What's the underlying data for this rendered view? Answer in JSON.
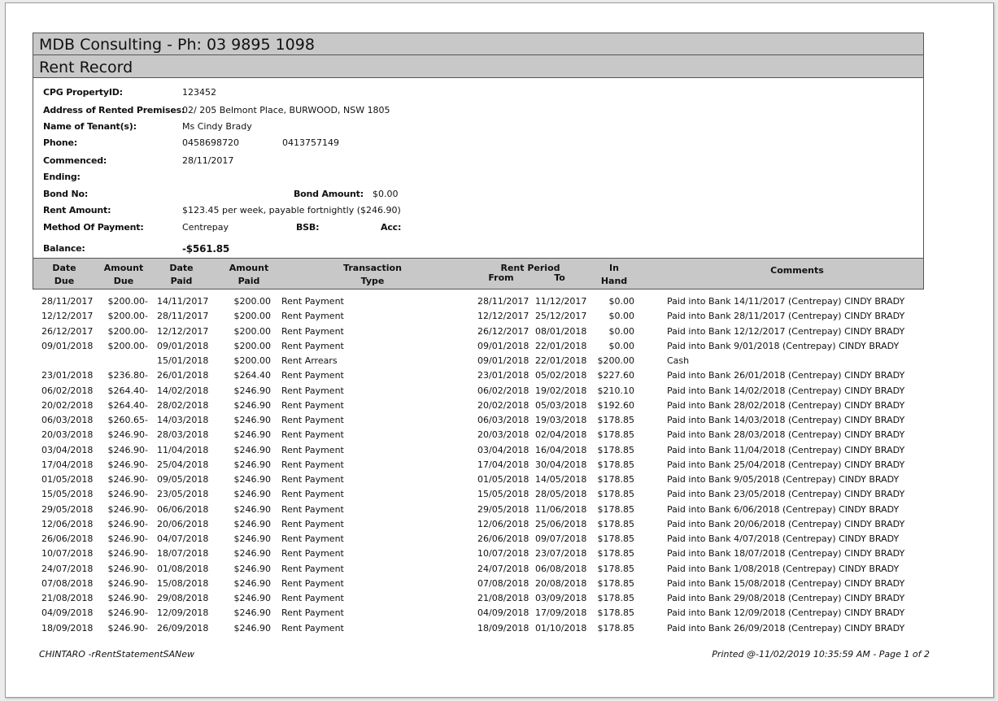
{
  "company_title": "MDB Consulting - Ph: 03 9895 1098",
  "report_title": "Rent Record",
  "info": {
    "property_id_label": "CPG PropertyID:",
    "property_id": "123452",
    "address_label": "Address of Rented Premises:",
    "address": "02/ 205 Belmont Place, BURWOOD, NSW 1805",
    "tenant_label": "Name of Tenant(s):",
    "tenant": "Ms Cindy Brady",
    "phone_label": "Phone:",
    "phone1": "0458698720",
    "phone2": "0413757149",
    "commenced_label": "Commenced:",
    "commenced": "28/11/2017",
    "ending_label": "Ending:",
    "ending": "",
    "bond_no_label": "Bond No:",
    "bond_no": "",
    "bond_amount_label": "Bond Amount:",
    "bond_amount": "$0.00",
    "rent_amount_label": "Rent Amount:",
    "rent_amount": "$123.45 per week, payable fortnightly ($246.90)",
    "method_label": "Method Of Payment:",
    "method": "Centrepay",
    "bsb_label": "BSB:",
    "acc_label": "Acc:",
    "balance_label": "Balance:",
    "balance": "-$561.85"
  },
  "columns": {
    "date_due": [
      "Date",
      "Due"
    ],
    "amount_due": [
      "Amount",
      "Due"
    ],
    "date_paid": [
      "Date",
      "Paid"
    ],
    "amount_paid": [
      "Amount",
      "Paid"
    ],
    "transaction_type": [
      "Transaction",
      "Type"
    ],
    "rent_period": "Rent Period",
    "from": "From",
    "to": "To",
    "in_hand": [
      "In",
      "Hand"
    ],
    "comments": "Comments"
  },
  "rows": [
    [
      "28/11/2017",
      "$200.00-",
      "14/11/2017",
      "$200.00",
      "Rent Payment",
      "28/11/2017",
      "11/12/2017",
      "$0.00",
      "Paid into Bank 14/11/2017 (Centrepay) CINDY BRADY"
    ],
    [
      "12/12/2017",
      "$200.00-",
      "28/11/2017",
      "$200.00",
      "Rent Payment",
      "12/12/2017",
      "25/12/2017",
      "$0.00",
      "Paid into Bank 28/11/2017 (Centrepay) CINDY BRADY"
    ],
    [
      "26/12/2017",
      "$200.00-",
      "12/12/2017",
      "$200.00",
      "Rent Payment",
      "26/12/2017",
      "08/01/2018",
      "$0.00",
      "Paid into Bank 12/12/2017 (Centrepay) CINDY BRADY"
    ],
    [
      "09/01/2018",
      "$200.00-",
      "09/01/2018",
      "$200.00",
      "Rent Payment",
      "09/01/2018",
      "22/01/2018",
      "$0.00",
      "Paid into Bank 9/01/2018 (Centrepay) CINDY BRADY"
    ],
    [
      "",
      "",
      "15/01/2018",
      "$200.00",
      "Rent Arrears",
      "09/01/2018",
      "22/01/2018",
      "$200.00",
      "Cash"
    ],
    [
      "23/01/2018",
      "$236.80-",
      "26/01/2018",
      "$264.40",
      "Rent Payment",
      "23/01/2018",
      "05/02/2018",
      "$227.60",
      "Paid into Bank 26/01/2018 (Centrepay) CINDY BRADY"
    ],
    [
      "06/02/2018",
      "$264.40-",
      "14/02/2018",
      "$246.90",
      "Rent Payment",
      "06/02/2018",
      "19/02/2018",
      "$210.10",
      "Paid into Bank 14/02/2018 (Centrepay) CINDY BRADY"
    ],
    [
      "20/02/2018",
      "$264.40-",
      "28/02/2018",
      "$246.90",
      "Rent Payment",
      "20/02/2018",
      "05/03/2018",
      "$192.60",
      "Paid into Bank 28/02/2018 (Centrepay) CINDY BRADY"
    ],
    [
      "06/03/2018",
      "$260.65-",
      "14/03/2018",
      "$246.90",
      "Rent Payment",
      "06/03/2018",
      "19/03/2018",
      "$178.85",
      "Paid into Bank 14/03/2018 (Centrepay) CINDY BRADY"
    ],
    [
      "20/03/2018",
      "$246.90-",
      "28/03/2018",
      "$246.90",
      "Rent Payment",
      "20/03/2018",
      "02/04/2018",
      "$178.85",
      "Paid into Bank 28/03/2018 (Centrepay) CINDY BRADY"
    ],
    [
      "03/04/2018",
      "$246.90-",
      "11/04/2018",
      "$246.90",
      "Rent Payment",
      "03/04/2018",
      "16/04/2018",
      "$178.85",
      "Paid into Bank 11/04/2018 (Centrepay) CINDY BRADY"
    ],
    [
      "17/04/2018",
      "$246.90-",
      "25/04/2018",
      "$246.90",
      "Rent Payment",
      "17/04/2018",
      "30/04/2018",
      "$178.85",
      "Paid into Bank 25/04/2018 (Centrepay) CINDY BRADY"
    ],
    [
      "01/05/2018",
      "$246.90-",
      "09/05/2018",
      "$246.90",
      "Rent Payment",
      "01/05/2018",
      "14/05/2018",
      "$178.85",
      "Paid into Bank 9/05/2018 (Centrepay) CINDY BRADY"
    ],
    [
      "15/05/2018",
      "$246.90-",
      "23/05/2018",
      "$246.90",
      "Rent Payment",
      "15/05/2018",
      "28/05/2018",
      "$178.85",
      "Paid into Bank 23/05/2018 (Centrepay) CINDY BRADY"
    ],
    [
      "29/05/2018",
      "$246.90-",
      "06/06/2018",
      "$246.90",
      "Rent Payment",
      "29/05/2018",
      "11/06/2018",
      "$178.85",
      "Paid into Bank 6/06/2018 (Centrepay) CINDY BRADY"
    ],
    [
      "12/06/2018",
      "$246.90-",
      "20/06/2018",
      "$246.90",
      "Rent Payment",
      "12/06/2018",
      "25/06/2018",
      "$178.85",
      "Paid into Bank 20/06/2018 (Centrepay) CINDY BRADY"
    ],
    [
      "26/06/2018",
      "$246.90-",
      "04/07/2018",
      "$246.90",
      "Rent Payment",
      "26/06/2018",
      "09/07/2018",
      "$178.85",
      "Paid into Bank 4/07/2018 (Centrepay) CINDY BRADY"
    ],
    [
      "10/07/2018",
      "$246.90-",
      "18/07/2018",
      "$246.90",
      "Rent Payment",
      "10/07/2018",
      "23/07/2018",
      "$178.85",
      "Paid into Bank 18/07/2018 (Centrepay) CINDY BRADY"
    ],
    [
      "24/07/2018",
      "$246.90-",
      "01/08/2018",
      "$246.90",
      "Rent Payment",
      "24/07/2018",
      "06/08/2018",
      "$178.85",
      "Paid into Bank 1/08/2018 (Centrepay) CINDY BRADY"
    ],
    [
      "07/08/2018",
      "$246.90-",
      "15/08/2018",
      "$246.90",
      "Rent Payment",
      "07/08/2018",
      "20/08/2018",
      "$178.85",
      "Paid into Bank 15/08/2018 (Centrepay) CINDY BRADY"
    ],
    [
      "21/08/2018",
      "$246.90-",
      "29/08/2018",
      "$246.90",
      "Rent Payment",
      "21/08/2018",
      "03/09/2018",
      "$178.85",
      "Paid into Bank 29/08/2018 (Centrepay) CINDY BRADY"
    ],
    [
      "04/09/2018",
      "$246.90-",
      "12/09/2018",
      "$246.90",
      "Rent Payment",
      "04/09/2018",
      "17/09/2018",
      "$178.85",
      "Paid into Bank 12/09/2018 (Centrepay) CINDY BRADY"
    ],
    [
      "18/09/2018",
      "$246.90-",
      "26/09/2018",
      "$246.90",
      "Rent Payment",
      "18/09/2018",
      "01/10/2018",
      "$178.85",
      "Paid into Bank 26/09/2018 (Centrepay) CINDY BRADY"
    ]
  ],
  "footer": {
    "left": "CHINTARO -rRentStatementSANew",
    "right": "Printed @-11/02/2019 10:35:59 AM - Page 1 of 2"
  },
  "colors": {
    "header_bg": "#c8c8c8",
    "border": "#555555"
  }
}
